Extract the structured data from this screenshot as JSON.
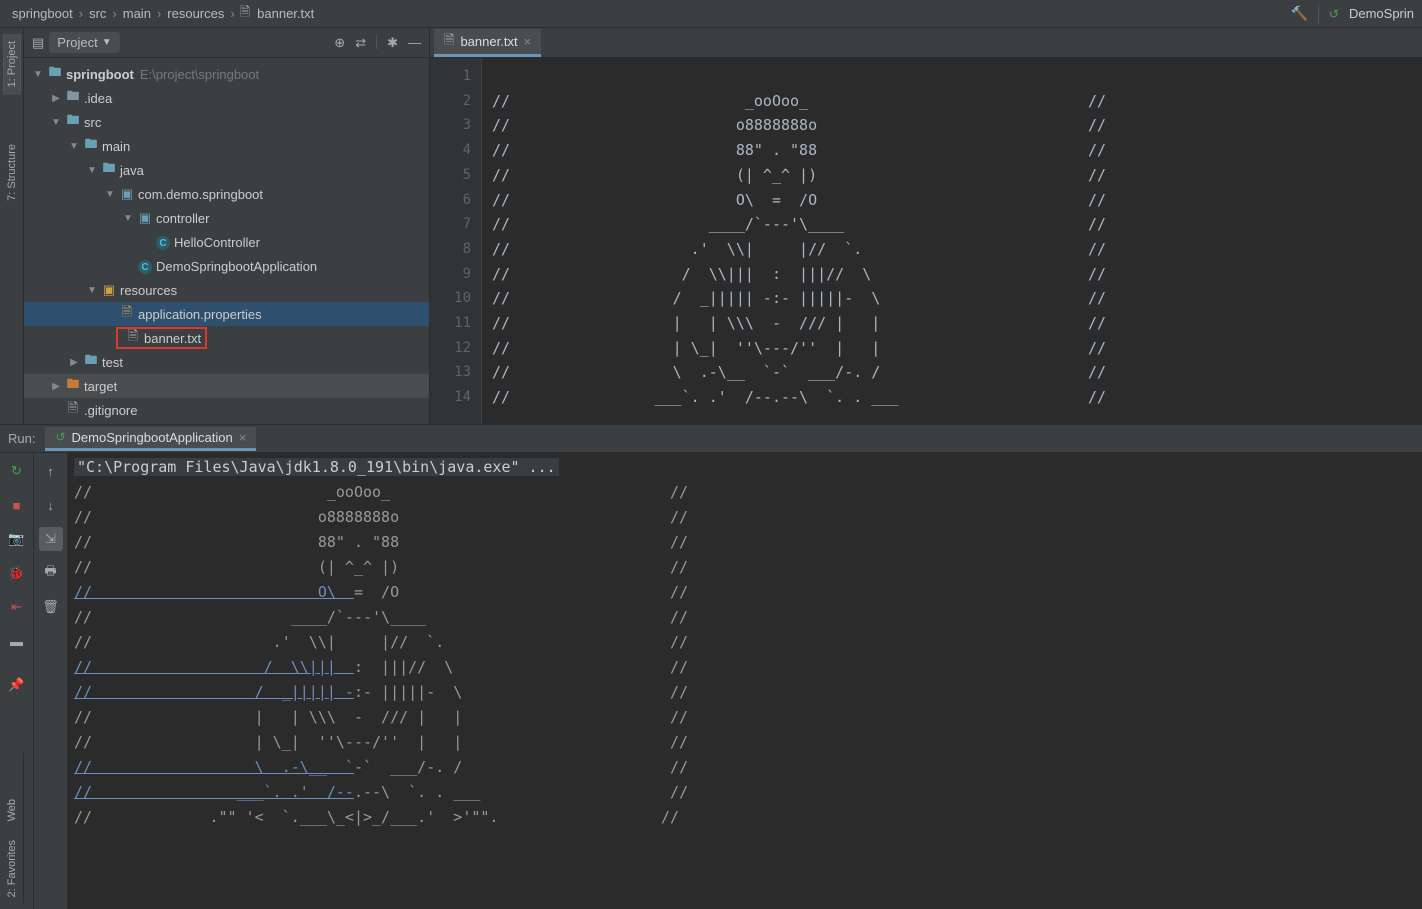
{
  "breadcrumb": {
    "items": [
      "springboot",
      "src",
      "main",
      "resources",
      "banner.txt"
    ]
  },
  "runconfig": {
    "name": "DemoSprin"
  },
  "sidebar_tabs": {
    "project": "1: Project",
    "structure": "7: Structure",
    "web": "Web",
    "fav": "2: Favorites"
  },
  "project_panel": {
    "title": "Project",
    "root": {
      "name": "springboot",
      "path": "E:\\project\\springboot"
    },
    "tree": [
      {
        "indent": 0,
        "arrow": "open",
        "icon": "folder-blue",
        "label": "springboot",
        "suffix": "E:\\project\\springboot",
        "bold": true
      },
      {
        "indent": 1,
        "arrow": "closed",
        "icon": "folder",
        "label": ".idea"
      },
      {
        "indent": 1,
        "arrow": "open",
        "icon": "folder-blue",
        "label": "src"
      },
      {
        "indent": 2,
        "arrow": "open",
        "icon": "folder-blue",
        "label": "main"
      },
      {
        "indent": 3,
        "arrow": "open",
        "icon": "folder-blue",
        "label": "java"
      },
      {
        "indent": 4,
        "arrow": "open",
        "icon": "package",
        "label": "com.demo.springboot"
      },
      {
        "indent": 5,
        "arrow": "open",
        "icon": "package",
        "label": "controller"
      },
      {
        "indent": 6,
        "arrow": "none",
        "icon": "class",
        "label": "HelloController"
      },
      {
        "indent": 5,
        "arrow": "none",
        "icon": "class",
        "label": "DemoSpringbootApplication"
      },
      {
        "indent": 3,
        "arrow": "open",
        "icon": "resources",
        "label": "resources"
      },
      {
        "indent": 4,
        "arrow": "none",
        "icon": "propfile",
        "label": "application.properties",
        "selected": true
      },
      {
        "indent": 4,
        "arrow": "none",
        "icon": "txtfile",
        "label": "banner.txt",
        "highlight": true
      },
      {
        "indent": 2,
        "arrow": "closed",
        "icon": "folder-blue",
        "label": "test"
      },
      {
        "indent": 1,
        "arrow": "closed",
        "icon": "folder-orange",
        "label": "target",
        "selected_alt": true
      },
      {
        "indent": 1,
        "arrow": "none",
        "icon": "txtfile",
        "label": ".gitignore"
      }
    ]
  },
  "editor": {
    "tab": {
      "filename": "banner.txt"
    },
    "lines": [
      "",
      "//                          _ooOoo_                               //",
      "//                         o8888888o                              //",
      "//                         88\" . \"88                              //",
      "//                         (| ^_^ |)                              //",
      "//                         O\\  =  /O                              //",
      "//                      ____/`---'\\____                           //",
      "//                    .'  \\\\|     |//  `.                         //",
      "//                   /  \\\\|||  :  |||//  \\                        //",
      "//                  /  _||||| -:- |||||-  \\                       //",
      "//                  |   | \\\\\\  -  /// |   |                       //",
      "//                  | \\_|  ''\\---/''  |   |                       //",
      "//                  \\  .-\\__  `-`  ___/-. /                       //",
      "//                ___`. .'  /--.--\\  `. . ___                     //"
    ]
  },
  "run": {
    "label": "Run:",
    "app": "DemoSpringbootApplication",
    "cmd": "\"C:\\Program Files\\Java\\jdk1.8.0_191\\bin\\java.exe\" ...",
    "banner": [
      "//                          _ooOoo_                               //",
      "//                         o8888888o                              //",
      "//                         88\" . \"88                              //",
      "//                         (| ^_^ |)                              //",
      "//                         O\\  =  /O                              //",
      "//                      ____/`---'\\____                           //",
      "//                    .'  \\\\|     |//  `.                         //",
      "//                   /  \\\\|||  :  |||//  \\                        //",
      "//                  /  _||||| -:- |||||-  \\                       //",
      "//                  |   | \\\\\\  -  /// |   |                       //",
      "//                  | \\_|  ''\\---/''  |   |                       //",
      "//                  \\  .-\\__  `-`  ___/-. /                       //",
      "//                ___`. .'  /--.--\\  `. . ___                     //",
      "//             .\"\" '<  `.___\\_<|>_/___.'  >'\"\".                  //"
    ],
    "link_indices": [
      4,
      7,
      8,
      11,
      12
    ]
  }
}
